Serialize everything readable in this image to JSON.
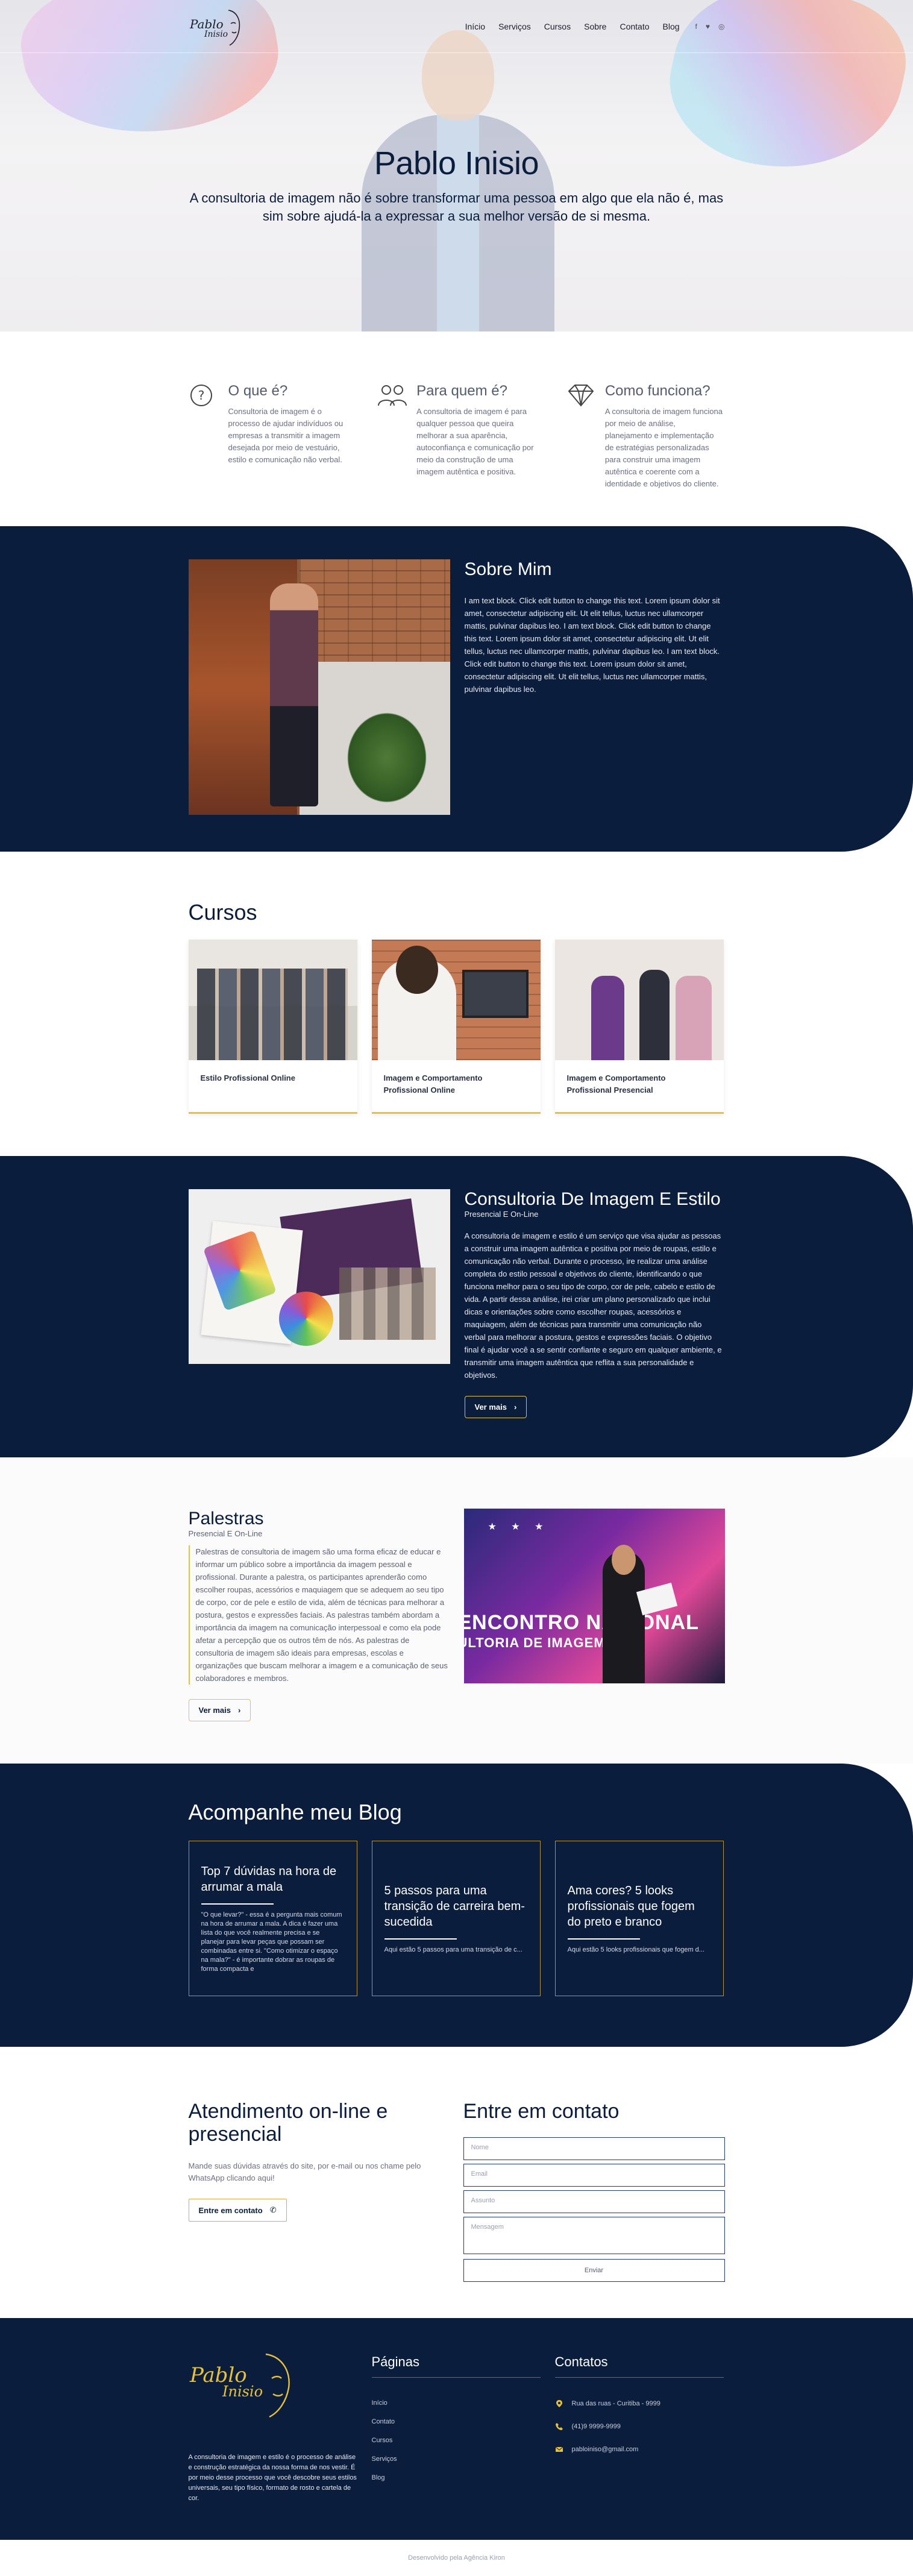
{
  "nav": {
    "brand": "Pablo Inisio",
    "items": [
      "Início",
      "Serviços",
      "Cursos",
      "Sobre",
      "Contato",
      "Blog"
    ],
    "social": [
      "facebook-icon",
      "twitter-icon",
      "instagram-icon"
    ]
  },
  "hero": {
    "title": "Pablo Inisio",
    "subtitle": "A consultoria de imagem não é sobre transformar uma pessoa em algo que ela não é, mas sim sobre ajudá-la a expressar a sua melhor versão de si mesma."
  },
  "features": [
    {
      "icon": "question-icon",
      "title": "O que é?",
      "text": "Consultoria de imagem é o processo de ajudar indivíduos ou empresas a transmitir a imagem desejada por meio de vestuário, estilo e comunicação não verbal."
    },
    {
      "icon": "people-icon",
      "title": "Para quem é?",
      "text": "A consultoria de imagem é para qualquer pessoa que queira melhorar a sua aparência, autoconfiança e comunicação por meio da construção de uma imagem autêntica e positiva."
    },
    {
      "icon": "diamond-icon",
      "title": "Como funciona?",
      "text": "A consultoria de imagem funciona por meio de análise, planejamento e implementação de estratégias personalizadas para construir uma imagem autêntica e coerente com a identidade e objetivos do cliente."
    }
  ],
  "about": {
    "title": "Sobre Mim",
    "text": "I am text block. Click edit button to change this text. Lorem ipsum dolor sit amet, consectetur adipiscing elit. Ut elit tellus, luctus nec ullamcorper mattis, pulvinar dapibus leo. I am text block. Click edit button to change this text. Lorem ipsum dolor sit amet, consectetur adipiscing elit. Ut elit tellus, luctus nec ullamcorper mattis, pulvinar dapibus leo. I am text block. Click edit button to change this text. Lorem ipsum dolor sit amet, consectetur adipiscing elit. Ut elit tellus, luctus nec ullamcorper mattis, pulvinar dapibus leo."
  },
  "courses": {
    "title": "Cursos",
    "items": [
      {
        "title": "Estilo Profissional Online"
      },
      {
        "title": "Imagem e Comportamento Profissional Online"
      },
      {
        "title": "Imagem e Comportamento Profissional Presencial"
      }
    ]
  },
  "consult": {
    "title": "Consultoria De Imagem E Estilo",
    "sub": "Presencial E On-Line",
    "text": "A consultoria de imagem e estilo é um serviço que visa ajudar as pessoas a construir uma imagem autêntica e positiva por meio de roupas, estilo e comunicação não verbal. Durante o processo, ire realizar uma análise completa do estilo pessoal e objetivos do cliente, identificando o que funciona melhor para o seu tipo de corpo, cor de pele, cabelo e estilo de vida. A partir dessa análise, irei criar um plano personalizado que inclui dicas e orientações sobre como escolher roupas, acessórios e maquiagem, além de técnicas para transmitir uma comunicação não verbal para melhorar a postura, gestos e expressões faciais. O objetivo final é ajudar você a se sentir confiante e seguro em qualquer ambiente, e transmitir uma imagem autêntica que reflita a sua personalidade e objetivos.",
    "button": "Ver mais"
  },
  "talks": {
    "title": "Palestras",
    "sub": "Presencial E On-Line",
    "text": "Palestras de consultoria de imagem são uma forma eficaz de educar e informar um público sobre a importância da imagem pessoal e profissional. Durante a palestra, os participantes aprenderão como escolher roupas, acessórios e maquiagem que se adequem ao seu tipo de corpo, cor de pele e estilo de vida, além de técnicas para melhorar a postura, gestos e expressões faciais. As palestras também abordam a importância da imagem na comunicação interpessoal e como ela pode afetar a percepção que os outros têm de nós. As palestras de consultoria de imagem são ideais para empresas, escolas e organizações que buscam melhorar a imagem e a comunicação de seus colaboradores e membros.",
    "button": "Ver mais",
    "image_text": "ENCONTRO NACIONAL",
    "image_text2": "ULTORIA DE IMAGEM"
  },
  "blog": {
    "title": "Acompanhe meu Blog",
    "posts": [
      {
        "title": "Top 7 dúvidas na hora de arrumar a mala",
        "excerpt": "\"O que levar?\" - essa é a pergunta mais comum na hora de arrumar a mala. A dica é fazer uma lista do que você realmente precisa e se planejar para levar peças que possam ser combinadas entre si. \"Como otimizar o espaço na mala?\" - é importante dobrar as roupas de forma compacta e"
      },
      {
        "title": "5 passos para uma transição de carreira bem-sucedida",
        "excerpt": "Aqui estão 5 passos para uma transição de c..."
      },
      {
        "title": "Ama cores? 5 looks profissionais que fogem do preto e branco",
        "excerpt": "Aqui estão 5 looks profissionais que fogem d..."
      }
    ]
  },
  "contact": {
    "left_title": "Atendimento on-line e presencial",
    "left_text": "Mande suas dúvidas através do site, por e-mail ou nos chame pelo WhatsApp clicando aqui!",
    "left_button": "Entre em contato",
    "form_title": "Entre em contato",
    "placeholders": {
      "name": "Nome",
      "email": "Email",
      "subject": "Assunto",
      "message": "Mensagem"
    },
    "submit": "Enviar"
  },
  "footer": {
    "brand": "Pablo Inisio",
    "about": "A consultoria de imagem e estilo é o processo de análise e construção estratégica da nossa forma de nos vestir. É por meio desse processo que você descobre seus estilos universais, seu tipo físico, formato de rosto e cartela de cor.",
    "pages_title": "Páginas",
    "pages": [
      "Início",
      "Contato",
      "Cursos",
      "Serviços",
      "Blog"
    ],
    "contacts_title": "Contatos",
    "contacts": [
      {
        "icon": "location-pin-icon",
        "text": "Rua das ruas - Curitiba - 9999"
      },
      {
        "icon": "phone-icon",
        "text": "(41)9 9999-9999"
      },
      {
        "icon": "envelope-icon",
        "text": "pabloiniso@gmail.com"
      }
    ],
    "credits": "Desenvolvido pela Agência Kiron"
  },
  "colors": {
    "navy": "#0b1d3c",
    "gold": "#e7c13a",
    "gold_dark": "#b7922f"
  }
}
